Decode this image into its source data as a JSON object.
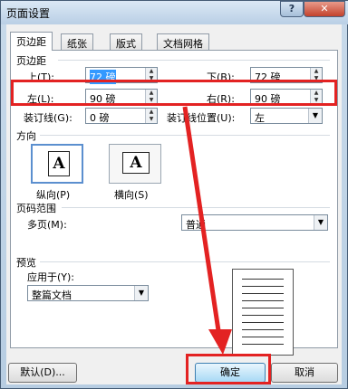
{
  "window": {
    "title": "页面设置",
    "help_glyph": "?",
    "close_glyph": "✕"
  },
  "tabs": [
    {
      "label": "页边距",
      "active": true
    },
    {
      "label": "纸张",
      "active": false
    },
    {
      "label": "版式",
      "active": false
    },
    {
      "label": "文档网格",
      "active": false
    }
  ],
  "margins": {
    "section_title": "页边距",
    "top_label": "上(T):",
    "top_value": "72 磅",
    "bottom_label": "下(B):",
    "bottom_value": "72 磅",
    "left_label": "左(L):",
    "left_value": "90 磅",
    "right_label": "右(R):",
    "right_value": "90 磅",
    "gutter_label": "装订线(G):",
    "gutter_value": "0 磅",
    "gutter_pos_label": "装订线位置(U):",
    "gutter_pos_value": "左"
  },
  "orientation": {
    "section_title": "方向",
    "portrait_label": "纵向(P)",
    "landscape_label": "横向(S)",
    "icon_letter": "A",
    "selected": "portrait"
  },
  "pages": {
    "section_title": "页码范围",
    "multiple_label": "多页(M):",
    "multiple_value": "普通"
  },
  "preview": {
    "section_title": "预览",
    "apply_label": "应用于(Y):",
    "apply_value": "整篇文档"
  },
  "buttons": {
    "default_label": "默认(D)...",
    "ok_label": "确定",
    "cancel_label": "取消"
  },
  "colors": {
    "accent_red": "#e32222",
    "selection_blue": "#3399ff"
  }
}
